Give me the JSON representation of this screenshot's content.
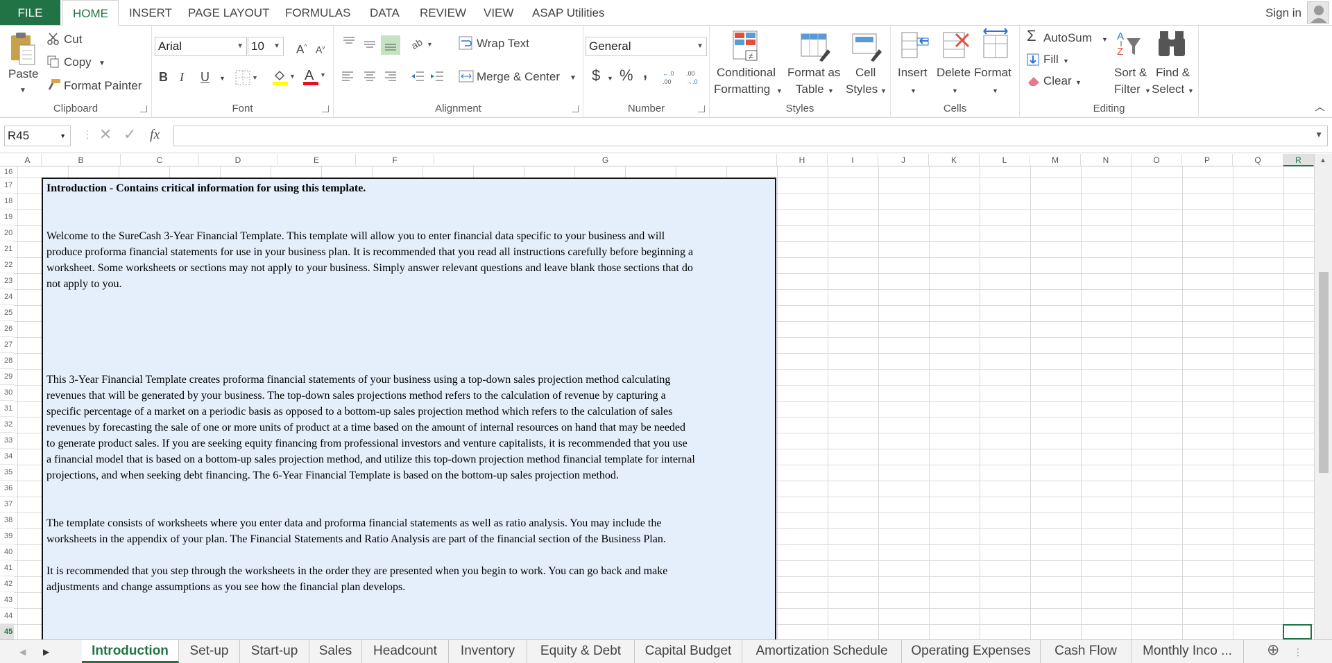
{
  "menu": {
    "file": "FILE",
    "tabs": [
      "HOME",
      "INSERT",
      "PAGE LAYOUT",
      "FORMULAS",
      "DATA",
      "REVIEW",
      "VIEW",
      "ASAP Utilities"
    ],
    "active_tab": "HOME",
    "signin": "Sign in"
  },
  "ribbon": {
    "clipboard": {
      "label": "Clipboard",
      "paste": "Paste",
      "cut": "Cut",
      "copy": "Copy",
      "format_painter": "Format Painter"
    },
    "font": {
      "label": "Font",
      "name": "Arial",
      "size": "10",
      "bold": "B",
      "italic": "I",
      "underline": "U"
    },
    "alignment": {
      "label": "Alignment",
      "wrap_text": "Wrap Text",
      "merge_center": "Merge & Center"
    },
    "number": {
      "label": "Number",
      "format": "General",
      "currency": "$",
      "percent": "%",
      "comma": ","
    },
    "styles": {
      "label": "Styles",
      "conditional": "Conditional",
      "formatting": "Formatting",
      "format_as": "Format as",
      "table": "Table",
      "cell": "Cell",
      "cell_styles": "Styles"
    },
    "cells": {
      "label": "Cells",
      "insert": "Insert",
      "delete": "Delete",
      "format": "Format"
    },
    "editing": {
      "label": "Editing",
      "autosum": "AutoSum",
      "fill": "Fill",
      "clear": "Clear",
      "sort": "Sort &",
      "filter": "Filter",
      "find": "Find &",
      "select": "Select"
    }
  },
  "formula_bar": {
    "name_box": "R45",
    "fx": "fx",
    "value": ""
  },
  "columns": [
    "A",
    "B",
    "C",
    "D",
    "E",
    "F",
    "G",
    "H",
    "I",
    "J",
    "K",
    "L",
    "M",
    "N",
    "O",
    "P",
    "Q",
    "R"
  ],
  "rows": [
    "16",
    "17",
    "18",
    "19",
    "20",
    "21",
    "22",
    "23",
    "24",
    "25",
    "26",
    "27",
    "28",
    "29",
    "30",
    "31",
    "32",
    "33",
    "34",
    "35",
    "36",
    "37",
    "38",
    "39",
    "40",
    "41",
    "42",
    "43",
    "44",
    "45"
  ],
  "intro": {
    "heading": "Introduction - Contains critical information for using this template.",
    "p1": "Welcome to the SureCash 3-Year Financial Template. This template will allow you to enter financial data specific to your business and will\nproduce proforma financial statements for use in your business plan. It is recommended that you read all instructions carefully before beginning a\nworksheet. Some worksheets or sections may not apply to your business. Simply answer relevant questions and leave blank those sections that do\nnot apply to you.",
    "p2": "This 3-Year Financial Template creates proforma financial statements of your business using a top-down sales projection method calculating\nrevenues that will be generated by your business.  The top-down sales projections method refers to the calculation of revenue by capturing a\nspecific percentage of a market on a periodic basis as opposed to a bottom-up sales projection method which refers to the calculation of sales\nrevenues by forecasting the sale of one or more units of product at a time based on the amount of internal resources on hand that may be needed\nto generate product sales.   If you are seeking equity financing from professional investors and venture capitalists, it is recommended that you use\na financial model that is based on a bottom-up sales projection method, and utilize this top-down projection method financial template for internal\nprojections, and when seeking debt financing.  The 6-Year Financial Template is based on the bottom-up sales projection method.",
    "p3": "The template consists of worksheets where you enter data and proforma financial statements as well as ratio analysis. You may include the\nworksheets in the appendix of your plan. The Financial Statements and Ratio Analysis are part of the financial section of the Business Plan.",
    "p4": "It is recommended that you step through the worksheets in the order they are presented when you begin to work. You can go back and make\nadjustments and change assumptions as you see how the financial plan develops."
  },
  "sheets": [
    "Introduction",
    "Set-up",
    "Start-up",
    "Sales",
    "Headcount",
    "Inventory",
    "Equity & Debt",
    "Capital Budget",
    "Amortization Schedule",
    "Operating Expenses",
    "Cash Flow",
    "Monthly Inco ..."
  ],
  "active_sheet": "Introduction",
  "colors": {
    "accent": "#217346",
    "intro_fill": "#e5eefb"
  }
}
